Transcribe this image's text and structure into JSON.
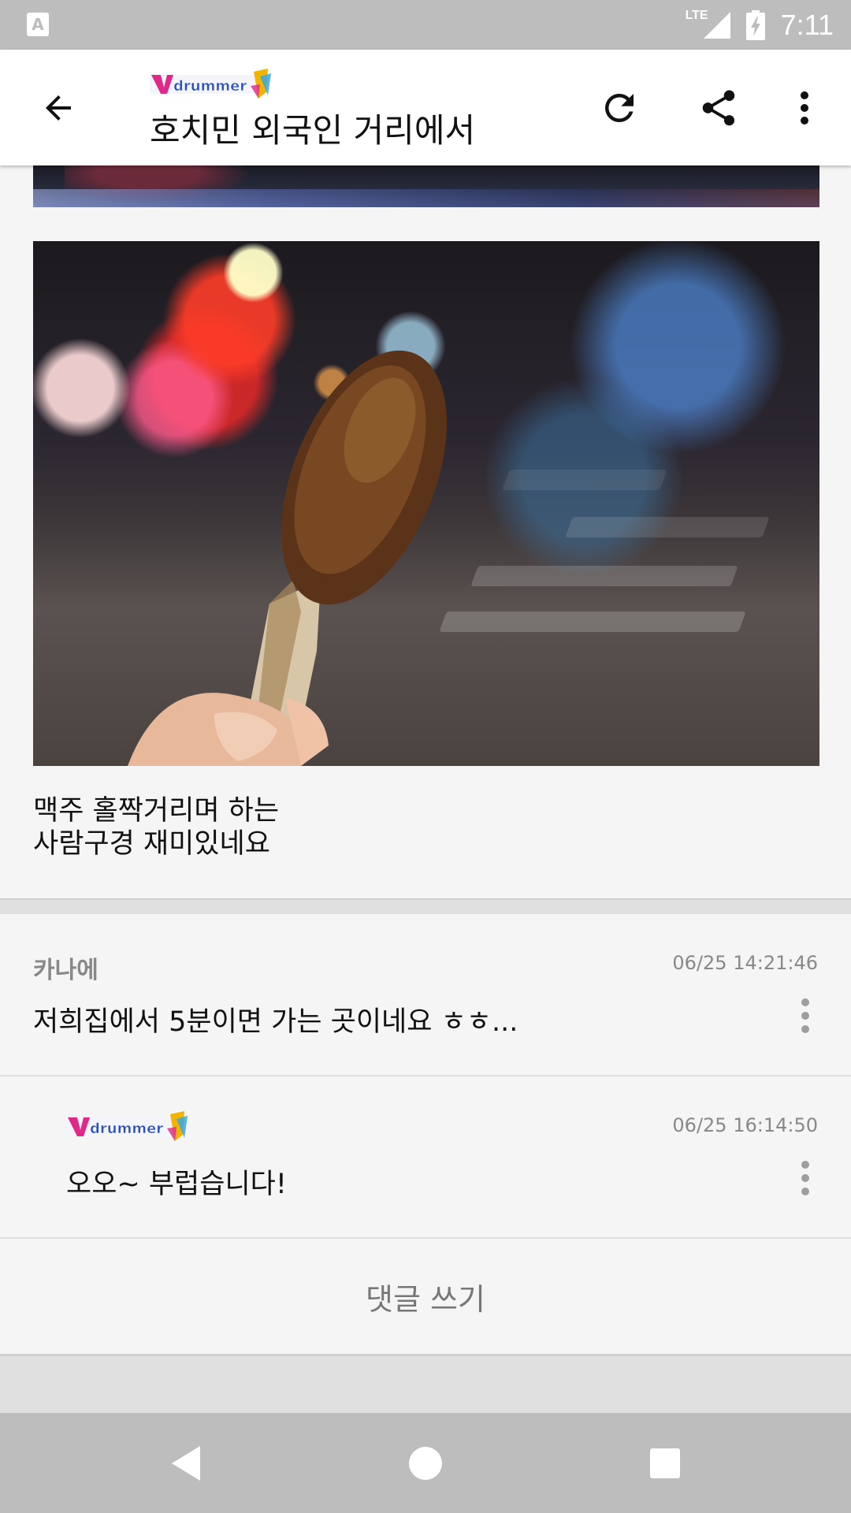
{
  "status_bar": {
    "network": "LTE",
    "time": "7:11",
    "notification_icon": "a-icon",
    "signal_icon": "signal-icon",
    "battery_icon": "battery-charging-icon"
  },
  "toolbar": {
    "logo_text": "Vdrummer",
    "title": "호치민 외국인 거리에서",
    "back_icon": "arrow-left-icon",
    "refresh_icon": "refresh-icon",
    "share_icon": "share-icon",
    "menu_icon": "more-vert-icon"
  },
  "post": {
    "caption_lines": [
      "맥주 홀짝거리며 하는",
      "사람구경 재미있네요"
    ]
  },
  "comments": [
    {
      "author": "카나에",
      "timestamp": "06/25 14:21:46",
      "text": "저희집에서 5분이면 가는 곳이네요 ㅎㅎ..."
    },
    {
      "author_logo_text": "Vdrummer",
      "timestamp": "06/25 16:14:50",
      "text": "오오~ 부럽습니다!"
    }
  ],
  "write_comment_label": "댓글 쓰기",
  "nav_bar": {
    "back_icon": "nav-back-icon",
    "home_icon": "nav-home-icon",
    "recents_icon": "nav-recents-icon"
  },
  "colors": {
    "status_bar": "#bdbdbd",
    "toolbar": "#ffffff",
    "content_bg": "#f5f5f5",
    "secondary_text": "#888888",
    "logo_pink": "#e0278a",
    "logo_blue": "#2a4fc4"
  }
}
